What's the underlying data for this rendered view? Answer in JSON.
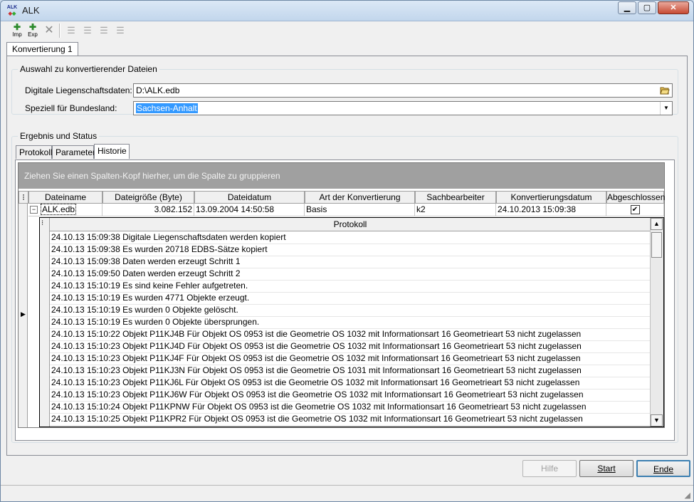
{
  "window": {
    "title": "ALK",
    "icon_text": "ALK"
  },
  "toolbar": {
    "imp_label": "Imp",
    "exp_label": "Exp"
  },
  "main_tab": "Konvertierung 1",
  "selection_group": {
    "legend": "Auswahl zu konvertierender Dateien",
    "file_label": "Digitale Liegenschaftsdaten:",
    "file_value": "D:\\ALK.edb",
    "state_label": "Speziell für Bundesland:",
    "state_value": "Sachsen-Anhalt"
  },
  "result_group": {
    "legend": "Ergebnis und Status",
    "tabs": [
      "Protokoll",
      "Parameter",
      "Historie"
    ]
  },
  "grid": {
    "group_hint": "Ziehen Sie einen Spalten-Kopf hierher, um die Spalte zu gruppieren",
    "columns": [
      "Dateiname",
      "Dateigröße (Byte)",
      "Dateidatum",
      "Art der Konvertierung",
      "Sachbearbeiter",
      "Konvertierungsdatum",
      "Abgeschlossen"
    ],
    "row": {
      "dateiname": "ALK.edb",
      "dateigroesse": "3.082.152",
      "dateidatum": "13.09.2004 14:50:58",
      "art": "Basis",
      "sachbearbeiter": "k2",
      "konvertierungsdatum": "24.10.2013 15:09:38",
      "abgeschlossen_mark": "✔"
    },
    "sub_header": "Protokoll",
    "log": [
      "24.10.13 15:09:38  Digitale Liegenschaftsdaten werden kopiert",
      "24.10.13 15:09:38  Es wurden 20718 EDBS-Sätze kopiert",
      "24.10.13 15:09:38  Daten werden erzeugt Schritt 1",
      "24.10.13 15:09:50  Daten werden erzeugt Schritt 2",
      "24.10.13 15:10:19  Es sind keine Fehler aufgetreten.",
      "24.10.13 15:10:19  Es wurden 4771 Objekte erzeugt.",
      "24.10.13 15:10:19  Es wurden 0 Objekte gelöscht.",
      "24.10.13 15:10:19  Es wurden 0 Objekte übersprungen.",
      "24.10.13 15:10:22  Objekt P11KJ4B Für Objekt OS 0953 ist die Geometrie OS 1032 mit Informationsart 16 Geometrieart 53 nicht zugelassen",
      "24.10.13 15:10:23  Objekt P11KJ4D Für Objekt OS 0953 ist die Geometrie OS 1032 mit Informationsart 16 Geometrieart 53 nicht zugelassen",
      "24.10.13 15:10:23  Objekt P11KJ4F Für Objekt OS 0953 ist die Geometrie OS 1032 mit Informationsart 16 Geometrieart 53 nicht zugelassen",
      "24.10.13 15:10:23  Objekt P11KJ3N Für Objekt OS 0953 ist die Geometrie OS 1031 mit Informationsart 16 Geometrieart 53 nicht zugelassen",
      "24.10.13 15:10:23  Objekt P11KJ6L Für Objekt OS 0953 ist die Geometrie OS 1032 mit Informationsart 16 Geometrieart 53 nicht zugelassen",
      "24.10.13 15:10:23  Objekt P11KJ6W Für Objekt OS 0953 ist die Geometrie OS 1032 mit Informationsart 16 Geometrieart 53 nicht zugelassen",
      "24.10.13 15:10:24  Objekt P11KPNW Für Objekt OS 0953 ist die Geometrie OS 1032 mit Informationsart 16 Geometrieart 53 nicht zugelassen",
      "24.10.13 15:10:25  Objekt P11KPR2 Für Objekt OS 0953 ist die Geometrie OS 1032 mit Informationsart 16 Geometrieart 53 nicht zugelassen"
    ]
  },
  "buttons": {
    "help": "Hilfe",
    "start": "Start",
    "end": "Ende"
  }
}
